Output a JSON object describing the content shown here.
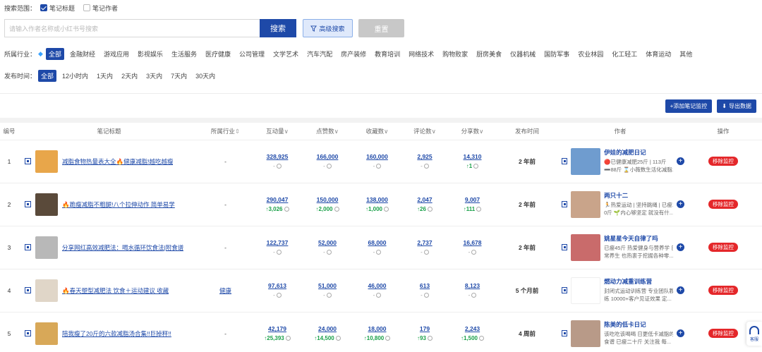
{
  "filters": {
    "scope_label": "搜索范围：",
    "scope_options": [
      {
        "label": "笔记标题",
        "checked": true
      },
      {
        "label": "笔记作者",
        "checked": false
      }
    ],
    "search_placeholder": "请输入作者名称或小红书号搜索",
    "search_button": "搜索",
    "advanced_button": "高级搜索",
    "reset_button": "重置",
    "industry_label": "所属行业：",
    "industries": [
      "全部",
      "金融财经",
      "游戏应用",
      "影视娱乐",
      "生活服务",
      "医疗健康",
      "公司管理",
      "文学艺术",
      "汽车汽配",
      "房产装修",
      "教育培训",
      "网络技术",
      "购物败家",
      "厨房美食",
      "仪器机械",
      "国防军事",
      "农业林园",
      "化工轻工",
      "体育运动",
      "其他"
    ],
    "time_label": "发布时间：",
    "times": [
      "全部",
      "12小时内",
      "1天内",
      "2天内",
      "3天内",
      "7天内",
      "30天内"
    ]
  },
  "actions": {
    "add_monitor": "+添加笔记监控",
    "export": "导出数据"
  },
  "table": {
    "headers": {
      "index": "编号",
      "title": "笔记标题",
      "industry": "所属行业",
      "interaction": "互动量",
      "likes": "点赞数",
      "favorites": "收藏数",
      "comments": "评论数",
      "shares": "分享数",
      "publish_time": "发布时间",
      "author": "作者",
      "operation": "操作"
    },
    "sort_up_down": "⇕",
    "chevron": "∨",
    "remove_label": "移除监控",
    "rows": [
      {
        "index": "1",
        "title": "减脂食物热量表大全🔥健康减脂!越吃越瘦",
        "industry": "-",
        "interaction": "328,925",
        "interaction_sub": "-",
        "likes": "166,000",
        "likes_sub": "-",
        "favorites": "160,000",
        "favorites_sub": "-",
        "comments": "2,925",
        "comments_sub": "-",
        "shares": "14,310",
        "shares_sub": "↑1",
        "time": "2 年前",
        "author_name": "伊娃的减肥日记",
        "author_desc1": "🔴已健康减肥25斤 | 113斤",
        "author_desc2": "➖88斤 ⌛小薇数生活化减脂...",
        "thumb_color": "#e8a64a",
        "avatar_color": "#6f9ccf"
      },
      {
        "index": "2",
        "title": "🔥跪瘦减脂不粗腿!八个拉伸动作 简单易学",
        "industry": "-",
        "interaction": "290,047",
        "interaction_sub": "↑3,026",
        "likes": "150,000",
        "likes_sub": "↑2,000",
        "favorites": "138,000",
        "favorites_sub": "↑1,000",
        "comments": "2,047",
        "comments_sub": "↑26",
        "shares": "9,007",
        "shares_sub": "↑111",
        "time": "2 年前",
        "author_name": "两只十二",
        "author_desc1": "🏃热爱运动 | 坚持跳绳 | 已瘦1",
        "author_desc2": "0斤 🌱内心够坚定 就没有什...",
        "thumb_color": "#5a4a3a",
        "avatar_color": "#c9a48a"
      },
      {
        "index": "3",
        "title": "分享网红高效减肥法：喝水循环饮食法|附食谱",
        "industry": "-",
        "interaction": "122,737",
        "interaction_sub": "-",
        "likes": "52,000",
        "likes_sub": "-",
        "favorites": "68,000",
        "favorites_sub": "-",
        "comments": "2,737",
        "comments_sub": "-",
        "shares": "16,678",
        "shares_sub": "-",
        "time": "2 年前",
        "author_name": "姚星星今天自律了吗",
        "author_desc1": "已瘦45斤 热爱健身与营养学 日",
        "author_desc2": "常养生 也热衷于挖掘各种零...",
        "thumb_color": "#b8b8b8",
        "avatar_color": "#c96b6b"
      },
      {
        "index": "4",
        "title": "🔥春天塑型减肥法 饮食＋运动建议 收藏",
        "industry": "健康",
        "interaction": "97,613",
        "interaction_sub": "-",
        "likes": "51,000",
        "likes_sub": "-",
        "favorites": "46,000",
        "favorites_sub": "-",
        "comments": "613",
        "comments_sub": "-",
        "shares": "8,123",
        "shares_sub": "-",
        "time": "5 个月前",
        "author_name": "燃动力减重训练营",
        "author_desc1": "封闭式运动训练营 专业团队教",
        "author_desc2": "练 10000+客户见证效果 定...",
        "thumb_color": "#e0d6c8",
        "avatar_color": "#ffffff"
      },
      {
        "index": "5",
        "title": "陪我瘦了20斤的六款减脂汤合集!!巨掉秤!!",
        "industry": "-",
        "interaction": "42,179",
        "interaction_sub": "↑25,393",
        "likes": "24,000",
        "likes_sub": "↑14,500",
        "favorites": "18,000",
        "favorites_sub": "↑10,800",
        "comments": "179",
        "comments_sub": "↑93",
        "shares": "2,243",
        "shares_sub": "↑1,500",
        "time": "4 周前",
        "author_name": "陈美的低卡日记",
        "author_desc1": "该吃吃该喝喝 日更低卡减脂的",
        "author_desc2": "食谱 已瘦二十斤 关注我 每...",
        "thumb_color": "#d8a858",
        "avatar_color": "#b89a88"
      }
    ]
  },
  "help": {
    "label": "客服"
  }
}
